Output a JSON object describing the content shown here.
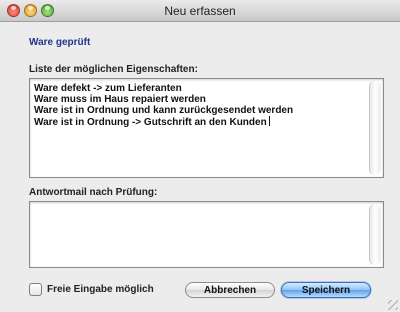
{
  "window": {
    "title": "Neu erfassen"
  },
  "header": {
    "status": "Ware geprüft"
  },
  "properties": {
    "label": "Liste der möglichen Eigenschaften:",
    "items": [
      "Ware defekt -> zum Lieferanten",
      "Ware muss im Haus repaiert werden",
      "Ware ist in Ordnung und kann zurückgesendet werden",
      "Ware ist in Ordnung -> Gutschrift an den Kunden"
    ]
  },
  "reply": {
    "label": "Antwortmail nach Prüfung:",
    "value": ""
  },
  "options": {
    "free_input_label": "Freie Eingabe möglich",
    "free_input_checked": false
  },
  "buttons": {
    "cancel": "Abbrechen",
    "save": "Speichern"
  },
  "icons": {
    "close": "close-icon",
    "minimize": "minimize-icon",
    "zoom": "zoom-icon"
  }
}
